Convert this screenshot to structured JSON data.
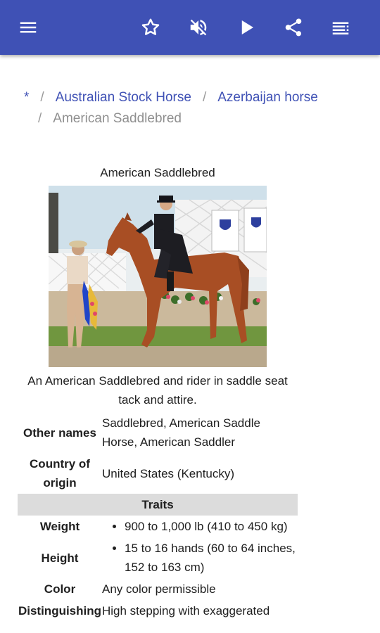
{
  "toolbar": {
    "icons": [
      "menu-icon",
      "star-icon",
      "mute-icon",
      "play-icon",
      "share-icon",
      "list-icon"
    ],
    "color": "#3f51b5"
  },
  "breadcrumb": {
    "root": "*",
    "items": [
      "Australian Stock Horse",
      "Azerbaijan horse"
    ],
    "current": "American Saddlebred",
    "separator": "/"
  },
  "infobox": {
    "title": "American Saddlebred",
    "image_caption": "An American Saddlebred and rider in saddle seat tack and attire.",
    "other_names_label": "Other names",
    "other_names_value": "Saddlebred, American Saddle Horse, American Saddler",
    "country_label": "Country of origin",
    "country_value": "United States (Kentucky)",
    "traits_header": "Traits",
    "weight_label": "Weight",
    "weight_value": "900 to 1,000 lb (410 to 450 kg)",
    "height_label": "Height",
    "height_value": "15 to 16 hands (60 to 64 inches, 152 to 163 cm)",
    "color_label": "Color",
    "color_value": "Any color permissible",
    "distinguishing_label": "Distinguishing",
    "distinguishing_value": "High stepping with exaggerated"
  }
}
